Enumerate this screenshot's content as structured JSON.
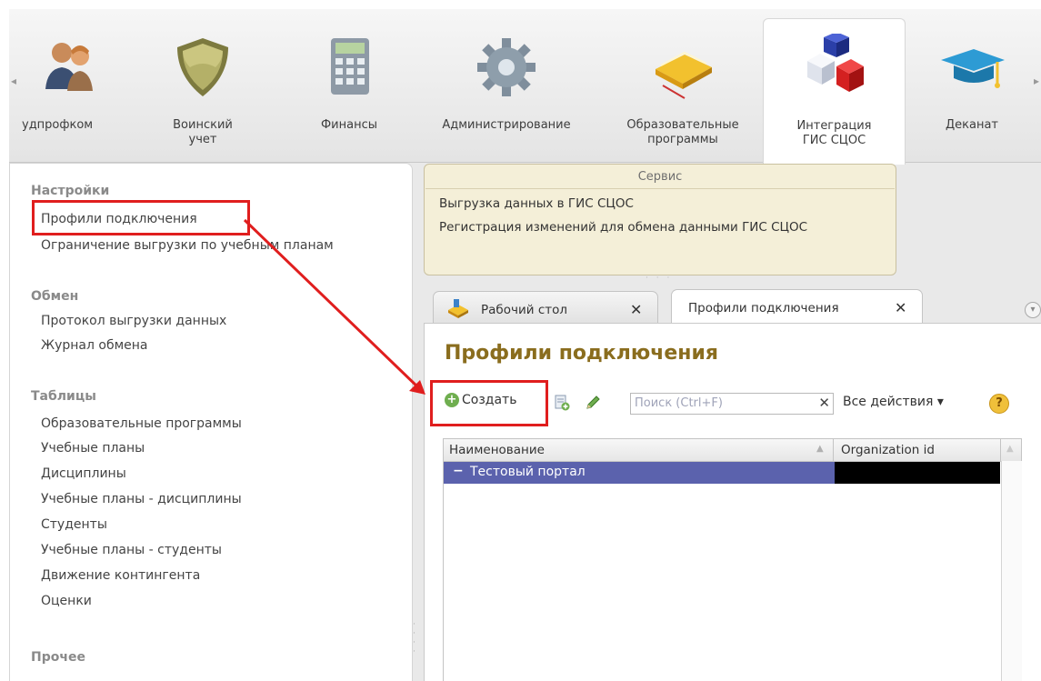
{
  "sections": [
    {
      "id": "trade-union",
      "label": "удпрофком",
      "icon": "people-icon"
    },
    {
      "id": "military",
      "label": "Воинский\nучет",
      "icon": "shield-icon"
    },
    {
      "id": "finance",
      "label": "Финансы",
      "icon": "calculator-icon"
    },
    {
      "id": "admin",
      "label": "Администрирование",
      "icon": "gear-icon"
    },
    {
      "id": "programs",
      "label": "Образовательные\nпрограммы",
      "icon": "books-icon"
    },
    {
      "id": "gis",
      "label": "Интеграция\nГИС СЦОС",
      "icon": "cubes-icon",
      "active": true
    },
    {
      "id": "dean",
      "label": "Деканат",
      "icon": "graduation-cap-icon"
    }
  ],
  "left_panel": {
    "groups": [
      {
        "title": "Настройки",
        "items": [
          "Профили подключения",
          "Ограничение выгрузки по учебным планам"
        ]
      },
      {
        "title": "Обмен",
        "items": [
          "Протокол выгрузки данных",
          "Журнал обмена"
        ]
      },
      {
        "title": "Таблицы",
        "items": [
          "Образовательные программы",
          "Учебные планы",
          "Дисциплины",
          "Учебные планы - дисциплины",
          "Студенты",
          "Учебные планы - студенты",
          "Движение контингента",
          "Оценки"
        ]
      },
      {
        "title": "Прочее",
        "items": []
      }
    ]
  },
  "service_panel": {
    "title": "Сервис",
    "links": [
      "Выгрузка данных в ГИС СЦОС",
      "Регистрация изменений для обмена данными ГИС СЦОС"
    ]
  },
  "tabs": [
    {
      "label": "Рабочий стол",
      "close": "✕",
      "icon": "desktop-icon"
    },
    {
      "label": "Профили подключения",
      "close": "✕",
      "active": true
    }
  ],
  "form": {
    "title": "Профили подключения",
    "create_label": "Создать",
    "search_placeholder": "Поиск (Ctrl+F)",
    "search_clear": "✕",
    "all_actions_label": "Все действия ▾",
    "help_label": "?"
  },
  "table": {
    "columns": [
      "Наименование",
      "Organization id"
    ],
    "rows": [
      {
        "name": "Тестовый портал",
        "organization_id": "",
        "selected": true,
        "organization_id_redacted": true
      }
    ]
  },
  "colors": {
    "annotation": "#e01e1e",
    "selection": "#5b62ad",
    "title": "#8a6d1e"
  }
}
